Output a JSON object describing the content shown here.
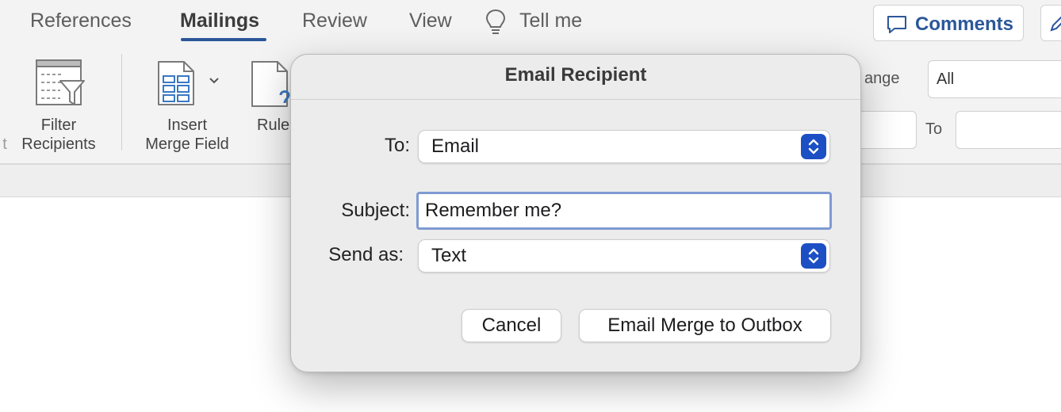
{
  "ribbon": {
    "tabs": [
      {
        "label": "References"
      },
      {
        "label": "Mailings",
        "active": true
      },
      {
        "label": "Review"
      },
      {
        "label": "View"
      }
    ],
    "tell_me": "Tell me",
    "comments_label": "Comments",
    "groups": {
      "partial_left": "t",
      "filter_line1": "Filter",
      "filter_line2": "Recipients",
      "insert_line1": "Insert",
      "insert_line2": "Merge Field",
      "rules_label": "Rule"
    },
    "range_label_partial": "ange",
    "range_select_value": "All",
    "to_label": "To",
    "accent_color": "#2b579a"
  },
  "dialog": {
    "title": "Email Recipient",
    "to_label": "To:",
    "to_value": "Email",
    "subject_label": "Subject:",
    "subject_value": "Remember me?",
    "send_as_label": "Send as:",
    "send_as_value": "Text",
    "cancel_label": "Cancel",
    "submit_label": "Email Merge to Outbox",
    "stepper_color": "#1d4fc4"
  }
}
